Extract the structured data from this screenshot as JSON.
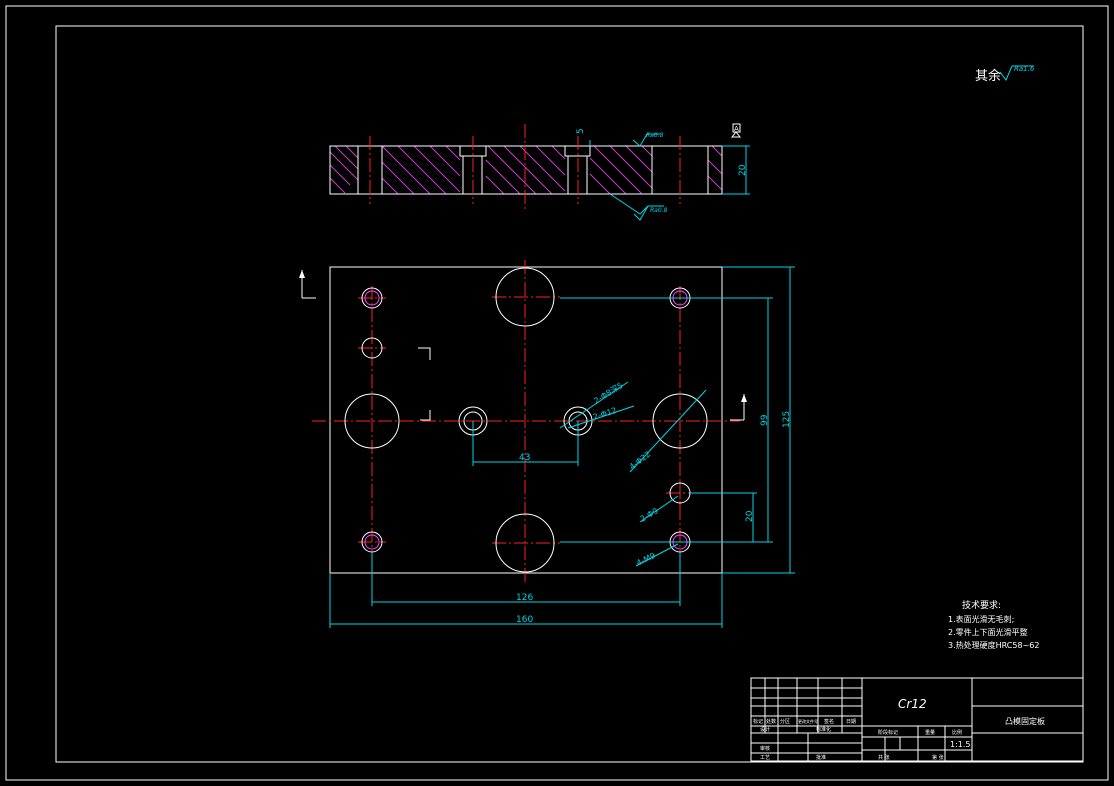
{
  "drawing": {
    "surface_note": "其余",
    "roughness_general": "Ra1.6",
    "roughness_top": "Ra0.8",
    "roughness_bottom": "Ra0.8",
    "datum_label": "A"
  },
  "dimensions": {
    "step_depth": "5",
    "thickness": "20",
    "width_total": "160",
    "width_holes": "126",
    "height_total": "125",
    "height_holes": "99",
    "offset_20": "20",
    "spacing_43": "43",
    "dia_counterbore": "2-Φ8深5",
    "dia_12": "2-Φ12",
    "dia_22": "4-Φ22",
    "dia_9": "2-Φ9",
    "thread_m9": "4-M9"
  },
  "tech_requirements": {
    "title": "技术要求:",
    "items": [
      "1.表面光滑无毛刺;",
      "2.零件上下面光滑平整",
      "3.热处理硬度HRC58~62"
    ]
  },
  "title_block": {
    "material": "Cr12",
    "part_name": "凸模固定板",
    "scale": "1:1.5",
    "labels": {
      "mark": "标记",
      "count": "处数",
      "zone": "分区",
      "change_doc": "更改文件号",
      "signature": "签名",
      "date": "日期",
      "designer": "设计",
      "standardize": "标准化",
      "stage_mark": "阶段标记",
      "weight": "重量",
      "ratio": "比例",
      "review": "审核",
      "process": "工艺",
      "approve": "批准",
      "sheet_total": "共  张",
      "sheet_no": "第  张"
    }
  }
}
